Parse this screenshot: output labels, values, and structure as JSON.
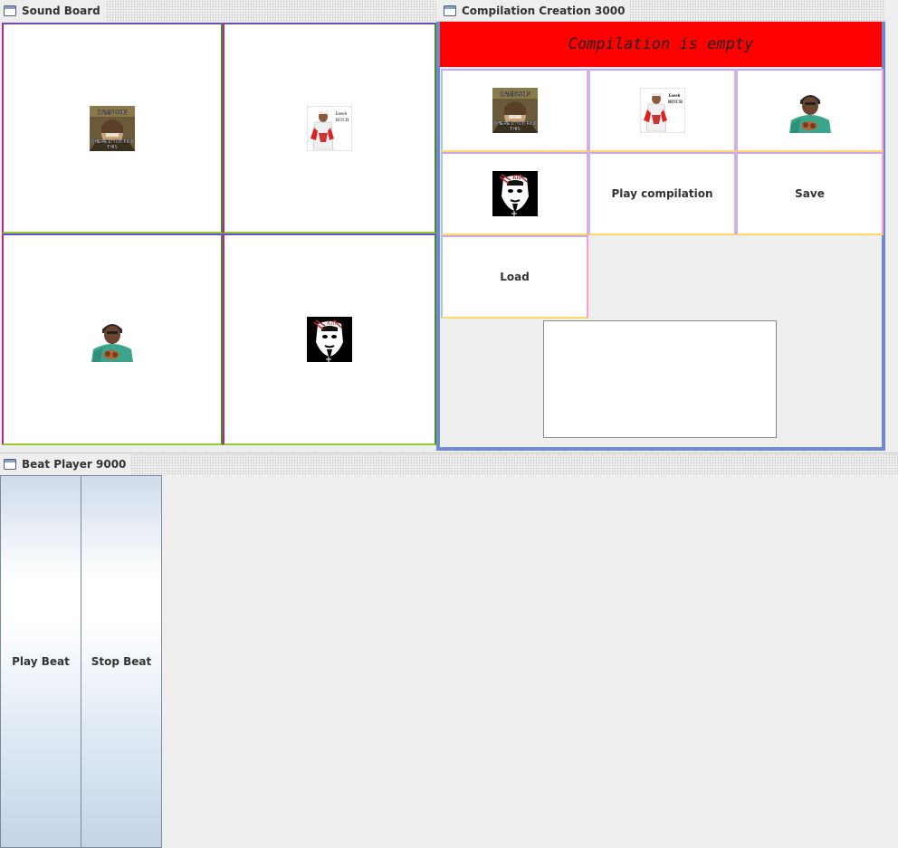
{
  "sound_board": {
    "title": "Sound Board",
    "pads": [
      {
        "icon": "damn-son-meme-icon",
        "caption_top": "DAMN SON",
        "caption_bottom": "WHERE'D YOU FIND THIS"
      },
      {
        "icon": "man-in-white-suit-icon",
        "caption_top": "Eeeeh",
        "caption_bottom": "BITCH"
      },
      {
        "icon": "rapper-portrait-icon"
      },
      {
        "icon": "dark-album-cover-icon"
      }
    ]
  },
  "compilation": {
    "title": "Compilation Creation 3000",
    "status": "Compilation is empty",
    "status_color": "#ff0000",
    "items": [
      {
        "icon": "damn-son-meme-icon",
        "caption_top": "DAMN SON",
        "caption_bottom": "WHERE'D YOU FIND THIS"
      },
      {
        "icon": "man-in-white-suit-icon",
        "caption_top": "Eeeeh",
        "caption_bottom": "BITCH"
      },
      {
        "icon": "rapper-portrait-icon"
      },
      {
        "icon": "dark-album-cover-icon"
      }
    ],
    "play_label": "Play compilation",
    "save_label": "Save",
    "load_label": "Load",
    "text_value": ""
  },
  "beat_player": {
    "title": "Beat Player 9000",
    "play_label": "Play Beat",
    "stop_label": "Stop Beat"
  }
}
